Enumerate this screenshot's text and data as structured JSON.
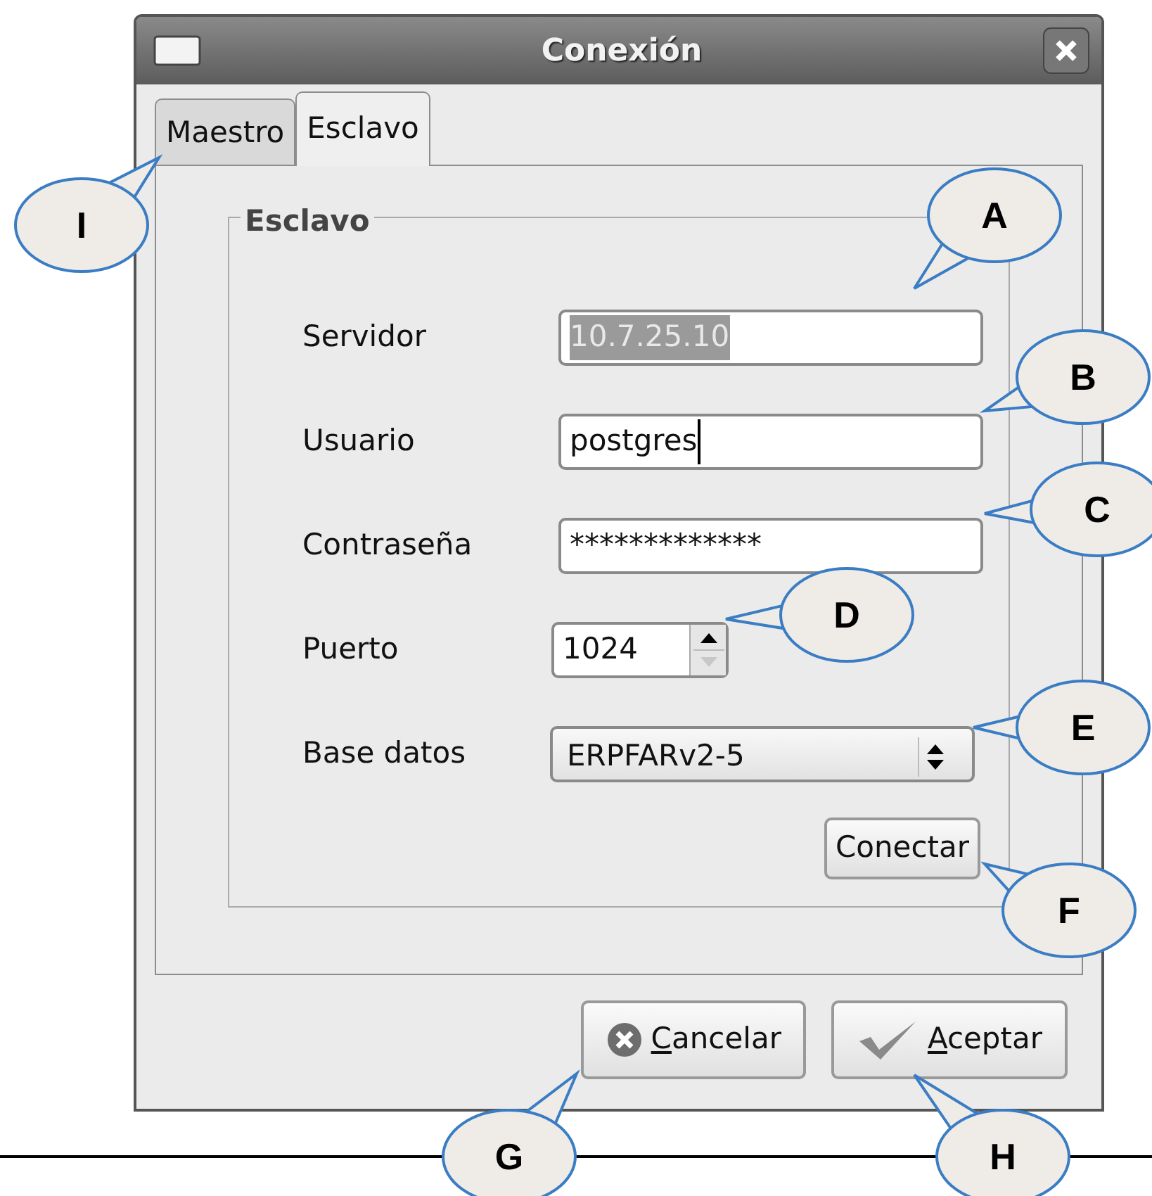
{
  "window": {
    "title": "Conexión"
  },
  "tabs": [
    {
      "label": "Maestro",
      "selected": false
    },
    {
      "label": "Esclavo",
      "selected": true
    }
  ],
  "frame": {
    "title": "Esclavo"
  },
  "fields": [
    {
      "kind": "entry",
      "label": "Servidor",
      "value": "10.7.25.10",
      "text_selected": true,
      "cursor": false
    },
    {
      "kind": "entry",
      "label": "Usuario",
      "value": "postgres",
      "text_selected": false,
      "cursor": true
    },
    {
      "kind": "entry",
      "label": "Contraseña",
      "value": "*************",
      "text_selected": false,
      "cursor": false
    },
    {
      "kind": "spin",
      "label": "Puerto",
      "value": "1024",
      "text_selected": false,
      "cursor": false
    },
    {
      "kind": "combo",
      "label": "Base datos",
      "value": "ERPFARv2-5",
      "text_selected": false,
      "cursor": false
    }
  ],
  "connect_button": {
    "label": "Conectar"
  },
  "buttons": [
    {
      "kind": "cancel",
      "label": "Cancelar"
    },
    {
      "kind": "ok",
      "label": "Aceptar"
    }
  ],
  "callouts": [
    {
      "letter": "A"
    },
    {
      "letter": "B"
    },
    {
      "letter": "C"
    },
    {
      "letter": "D"
    },
    {
      "letter": "E"
    },
    {
      "letter": "F"
    },
    {
      "letter": "G"
    },
    {
      "letter": "H"
    },
    {
      "letter": "I"
    }
  ]
}
